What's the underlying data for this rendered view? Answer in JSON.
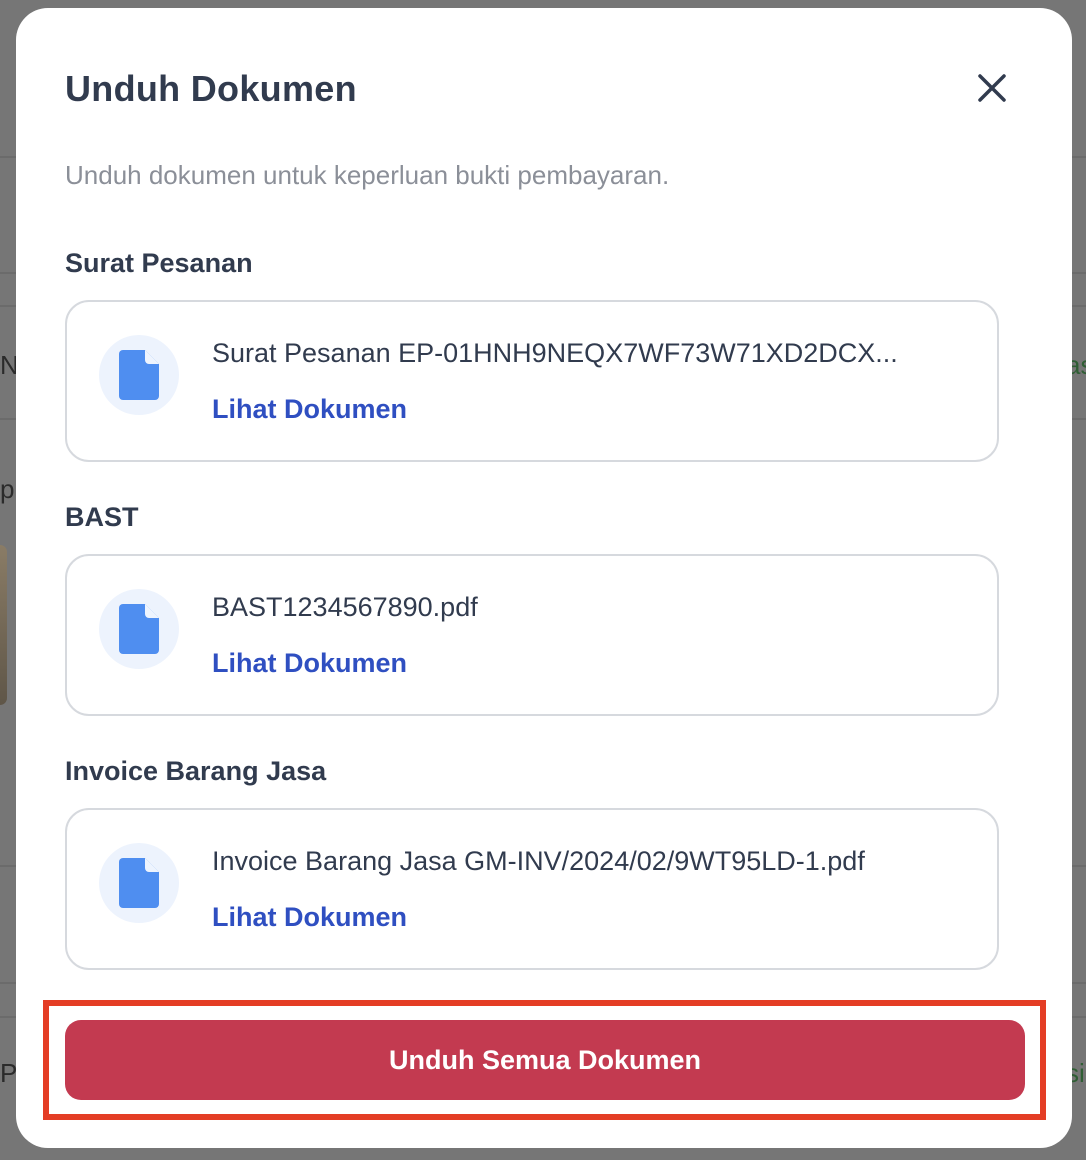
{
  "background": {
    "fragments": [
      "N",
      "p",
      "PT"
    ],
    "status_fragments": [
      "as",
      "si"
    ]
  },
  "modal": {
    "title": "Unduh Dokumen",
    "close_icon": "close-icon",
    "description": "Unduh dokumen untuk keperluan bukti pembayaran.",
    "sections": [
      {
        "label": "Surat Pesanan",
        "file_name": "Surat Pesanan EP-01HNH9NEQX7WF73W71XD2DCX...",
        "link_label": "Lihat Dokumen",
        "icon": "document-icon"
      },
      {
        "label": "BAST",
        "file_name": "BAST1234567890.pdf",
        "link_label": "Lihat Dokumen",
        "icon": "document-icon"
      },
      {
        "label": "Invoice Barang Jasa",
        "file_name": "Invoice Barang Jasa GM-INV/2024/02/9WT95LD-1.pdf",
        "link_label": "Lihat Dokumen",
        "icon": "document-icon"
      }
    ],
    "download_all_label": "Unduh Semua Dokumen"
  },
  "colors": {
    "primary_button": "#c33a50",
    "link": "#2f4fc1",
    "highlight": "#e43d25",
    "icon": "#4f8ef0"
  }
}
